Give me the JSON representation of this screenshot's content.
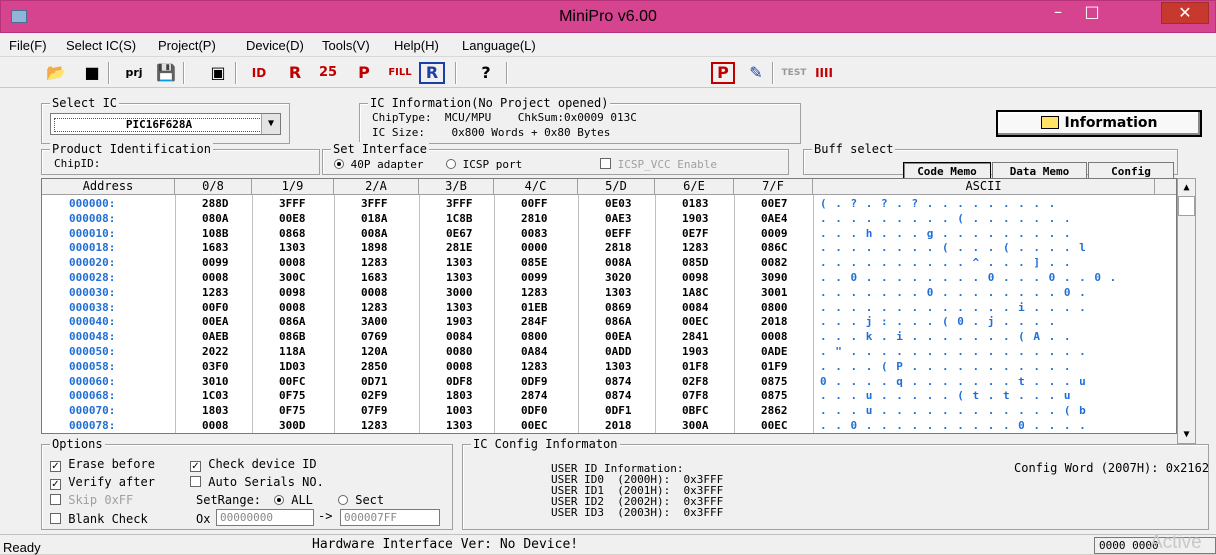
{
  "window": {
    "title": "MiniPro v6.00",
    "minimize": "–",
    "maximize": "□",
    "close": "✕"
  },
  "menu": [
    "File(F)",
    "Select IC(S)",
    "Project(P)",
    "Device(D)",
    "Tools(V)",
    "Help(H)",
    "Language(L)"
  ],
  "toolbar": {
    "open": "📂",
    "save": "■",
    "prj": "prj",
    "saveas": "💾",
    "print": "▣",
    "id": "ID",
    "rp": "R",
    "ch": "25",
    "pg": "P",
    "fill": "FILL",
    "r": "R",
    "help": "?",
    "p2": "P",
    "edit": "✎",
    "test": "TEST",
    "chip": "IIII"
  },
  "select_ic": {
    "label": "Select IC",
    "value": "PIC16F628A"
  },
  "ic_info": {
    "label": "IC Information(No Project opened)",
    "chiptype_line": "ChipType:  MCU/MPU    ChkSum:0x0009 013C",
    "size_line": "IC Size:    0x800 Words + 0x80 Bytes"
  },
  "information_button": "Information",
  "product": {
    "label": "Product Identification",
    "chipid": "ChipID:"
  },
  "interface": {
    "label": "Set Interface",
    "opt1": "40P adapter",
    "opt2": "ICSP port",
    "vcc": "ICSP_VCC Enable"
  },
  "buff": {
    "label": "Buff select",
    "code": "Code Memo",
    "data": "Data Memo",
    "config": "Config"
  },
  "grid": {
    "headers": [
      "Address",
      "0/8",
      "1/9",
      "2/A",
      "3/B",
      "4/C",
      "5/D",
      "6/E",
      "7/F",
      "ASCII"
    ],
    "rows": [
      [
        "000000:",
        "288D",
        "3FFF",
        "3FFF",
        "3FFF",
        "00FF",
        "0E03",
        "0183",
        "00E7",
        "( . ? . ? . ? . . . . . . . . ."
      ],
      [
        "000008:",
        "080A",
        "00E8",
        "018A",
        "1C8B",
        "2810",
        "0AE3",
        "1903",
        "0AE4",
        ". . . . . . . . . ( . . . . . . ."
      ],
      [
        "000010:",
        "108B",
        "0868",
        "008A",
        "0E67",
        "0083",
        "0EFF",
        "0E7F",
        "0009",
        ". . . h . . . g . . . . . . . . ."
      ],
      [
        "000018:",
        "1683",
        "1303",
        "1898",
        "281E",
        "0000",
        "2818",
        "1283",
        "086C",
        ". . . . . . . . ( . . . ( . . . . l"
      ],
      [
        "000020:",
        "0099",
        "0008",
        "1283",
        "1303",
        "085E",
        "008A",
        "085D",
        "0082",
        ". . . . . . . . . . ^ . . . ] . ."
      ],
      [
        "000028:",
        "0008",
        "300C",
        "1683",
        "1303",
        "0099",
        "3020",
        "0098",
        "3090",
        ". . 0 . . . . . . . . 0 . . . 0 . . 0 ."
      ],
      [
        "000030:",
        "1283",
        "0098",
        "0008",
        "3000",
        "1283",
        "1303",
        "1A8C",
        "3001",
        ". . . . . . . 0 . . . . . . . . 0 ."
      ],
      [
        "000038:",
        "00F0",
        "0008",
        "1283",
        "1303",
        "01EB",
        "0869",
        "0084",
        "0800",
        ". . . . . . . . . . . . . i . . . ."
      ],
      [
        "000040:",
        "00EA",
        "086A",
        "3A00",
        "1903",
        "284F",
        "086A",
        "00EC",
        "2018",
        ". . . j : . . . ( 0 . j . . . ."
      ],
      [
        "000048:",
        "0AEB",
        "086B",
        "0769",
        "0084",
        "0800",
        "00EA",
        "2841",
        "0008",
        ". . . k . i . . . . . . . ( A . ."
      ],
      [
        "000050:",
        "2022",
        "118A",
        "120A",
        "0080",
        "0A84",
        "0ADD",
        "1903",
        "0ADE",
        ". \" . . . . . . . . . . . . . . . ."
      ],
      [
        "000058:",
        "03F0",
        "1D03",
        "2850",
        "0008",
        "1283",
        "1303",
        "01F8",
        "01F9",
        ". . . . ( P . . . . . . . . . . ."
      ],
      [
        "000060:",
        "3010",
        "00FC",
        "0D71",
        "0DF8",
        "0DF9",
        "0874",
        "02F8",
        "0875",
        "0 . . . . q . . . . . . . t . . . u"
      ],
      [
        "000068:",
        "1C03",
        "0F75",
        "02F9",
        "1803",
        "2874",
        "0874",
        "07F8",
        "0875",
        ". . . u . . . . . ( t . t . . . u"
      ],
      [
        "000070:",
        "1803",
        "0F75",
        "07F9",
        "1003",
        "0DF0",
        "0DF1",
        "0BFC",
        "2862",
        ". . . u . . . . . . . . . . . . ( b"
      ],
      [
        "000078:",
        "0008",
        "300D",
        "1283",
        "1303",
        "00EC",
        "2018",
        "300A",
        "00EC",
        ". . 0 . . . . . . . . . . 0 . . . ."
      ]
    ]
  },
  "options": {
    "label": "Options",
    "erase": "Erase before",
    "check_id": "Check device ID",
    "verify": "Verify after",
    "auto_serial": "Auto Serials NO.",
    "skip": "Skip 0xFF",
    "setrange": "SetRange:",
    "all": "ALL",
    "sect": "Sect",
    "blank": "Blank Check",
    "ox": "Ox",
    "from": "00000000",
    "arrow": "->",
    "to": "000007FF"
  },
  "config_info": {
    "label": "IC Config Informaton",
    "user_id": "USER ID Information:",
    "id0": "USER ID0  (2000H):  0x3FFF",
    "id1": "USER ID1  (2001H):  0x3FFF",
    "id2": "USER ID2  (2002H):  0x3FFF",
    "id3": "USER ID3  (2003H):  0x3FFF",
    "config_word": "Config Word (2007H): 0x2162"
  },
  "status": {
    "ready": "Ready",
    "hw": "Hardware Interface Ver: No Device!",
    "count": "0000 0000",
    "watermark": "Active"
  }
}
